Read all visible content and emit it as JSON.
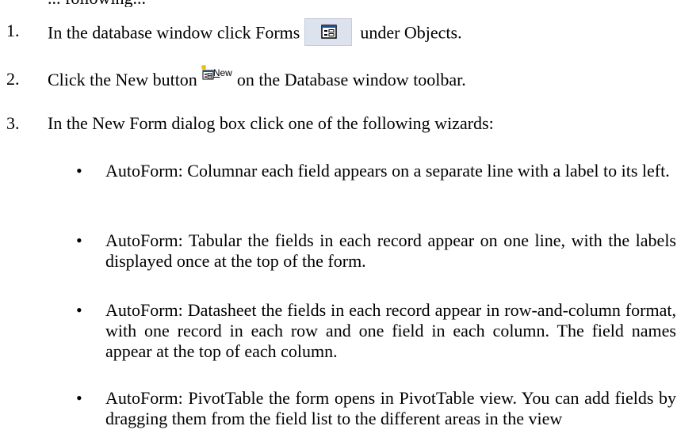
{
  "partial_top": "... following...",
  "steps": [
    {
      "number": "1.",
      "text_before": "In the database window click Forms",
      "icon": "forms-icon",
      "text_after": "under Objects."
    },
    {
      "number": "2.",
      "text_before": "Click the New button",
      "icon": "new-button-icon",
      "icon_label_first": "N",
      "icon_label_rest": "ew",
      "text_after": "on the Database window toolbar."
    },
    {
      "number": "3.",
      "text": "In the New Form dialog box click one of the following wizards:"
    }
  ],
  "bullets": [
    {
      "symbol": "•",
      "text": "AutoForm: Columnar   each field appears on a separate line with a label to its left."
    },
    {
      "symbol": "•",
      "text": "AutoForm: Tabular   the fields in each record appear on one line, with the labels displayed once at the top of the form."
    },
    {
      "symbol": "•",
      "text": "AutoForm: Datasheet   the fields in each record appear in row-and-column format, with one record in each row and one field in each column. The field names appear at the top of each column."
    },
    {
      "symbol": "•",
      "text": "AutoForm: PivotTable   the form opens in PivotTable view. You can add fields by dragging them from the field list to the different areas in the view"
    }
  ],
  "colors": {
    "icon_bg": "#dde3ee",
    "icon_accent": "#e8c000",
    "icon_blue": "#1f4f9a"
  }
}
